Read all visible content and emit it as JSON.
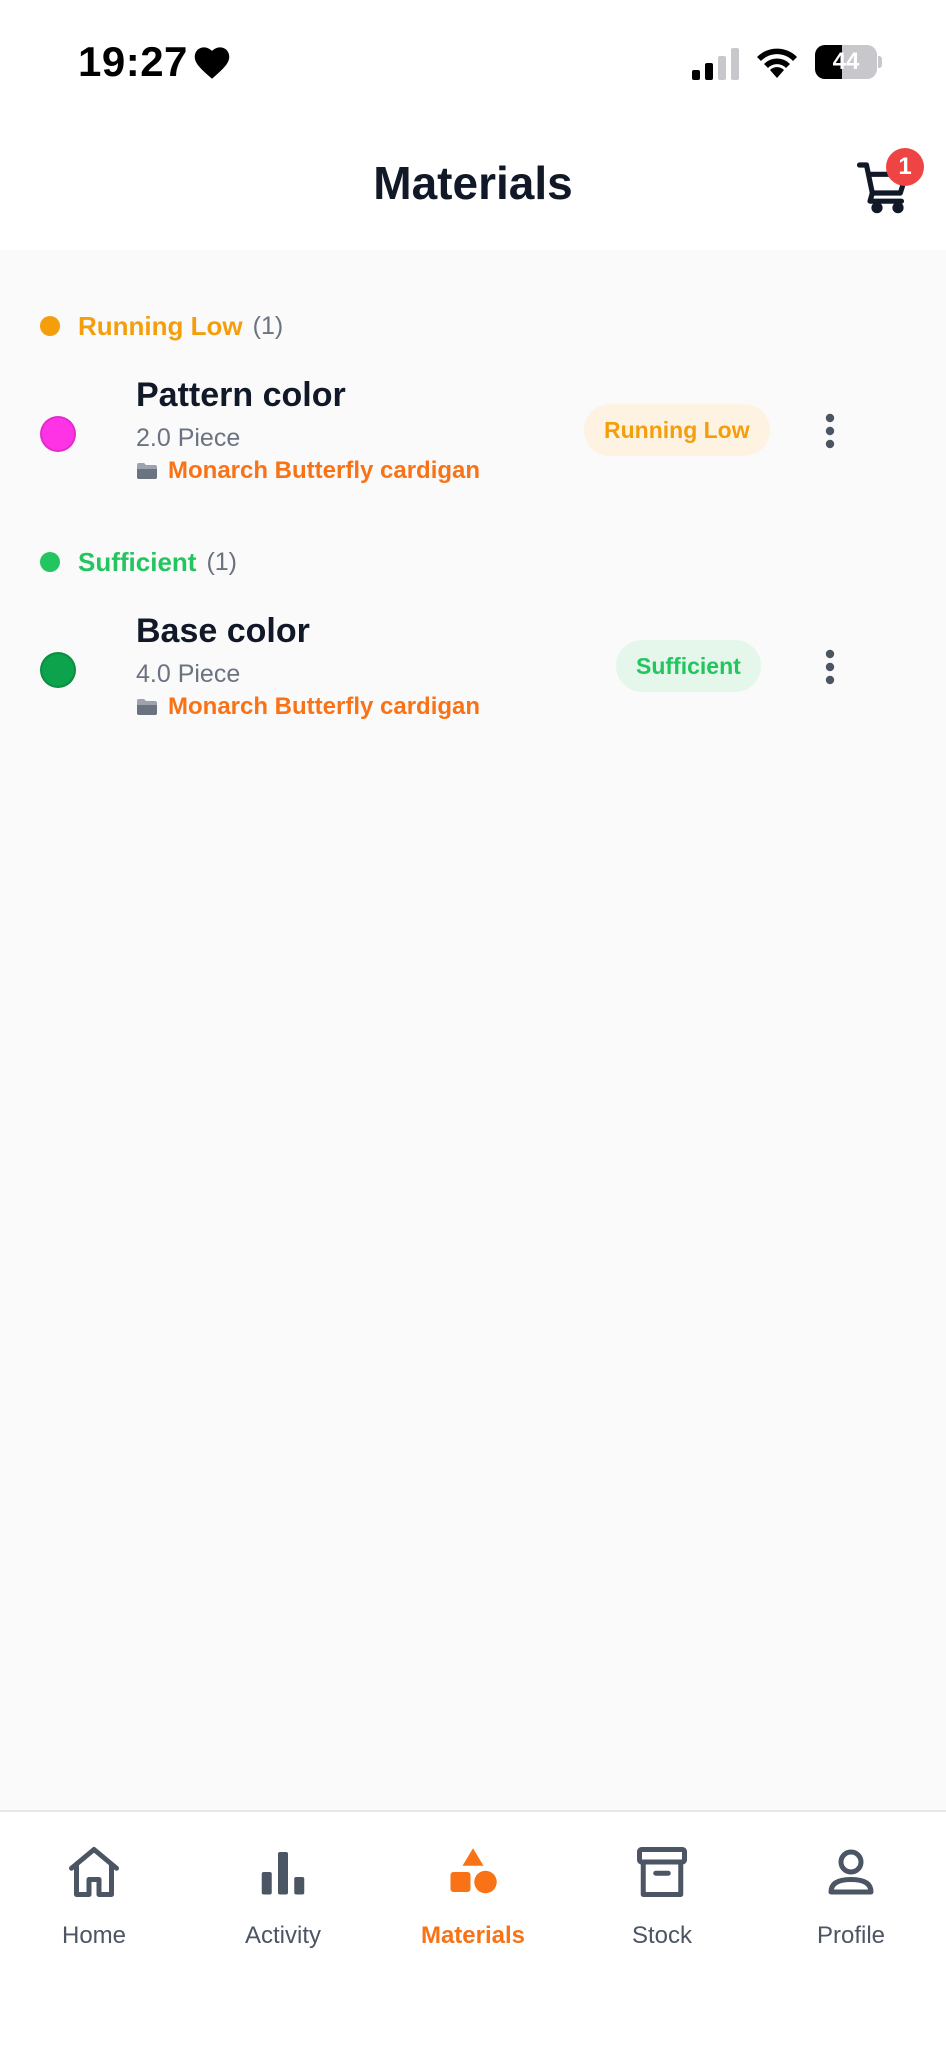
{
  "status_bar": {
    "time": "19:27",
    "battery": "44",
    "battery_level": 0.44
  },
  "header": {
    "title": "Materials",
    "cart_count": "1"
  },
  "colors": {
    "accent": "#f97316",
    "running_low": "#f59e0b",
    "running_low_bg": "#fef3e2",
    "sufficient": "#22c55e",
    "sufficient_bg": "#e4f7ea",
    "badge": "#ef4444"
  },
  "sections": [
    {
      "label": "Running Low",
      "count": "(1)",
      "color": "#f59e0b",
      "items": [
        {
          "name": "Pattern color",
          "quantity": "2.0 Piece",
          "project": "Monarch Butterfly cardigan",
          "status": "Running Low",
          "swatch": "#ff33e6"
        }
      ]
    },
    {
      "label": "Sufficient",
      "count": "(1)",
      "color": "#22c55e",
      "items": [
        {
          "name": "Base color",
          "quantity": "4.0 Piece",
          "project": "Monarch Butterfly cardigan",
          "status": "Sufficient",
          "swatch": "#0da24c"
        }
      ]
    }
  ],
  "nav": {
    "active": "Materials",
    "items": [
      {
        "label": "Home",
        "icon": "home-icon"
      },
      {
        "label": "Activity",
        "icon": "bar-chart-icon"
      },
      {
        "label": "Materials",
        "icon": "shapes-icon"
      },
      {
        "label": "Stock",
        "icon": "archive-box-icon"
      },
      {
        "label": "Profile",
        "icon": "user-icon"
      }
    ]
  }
}
